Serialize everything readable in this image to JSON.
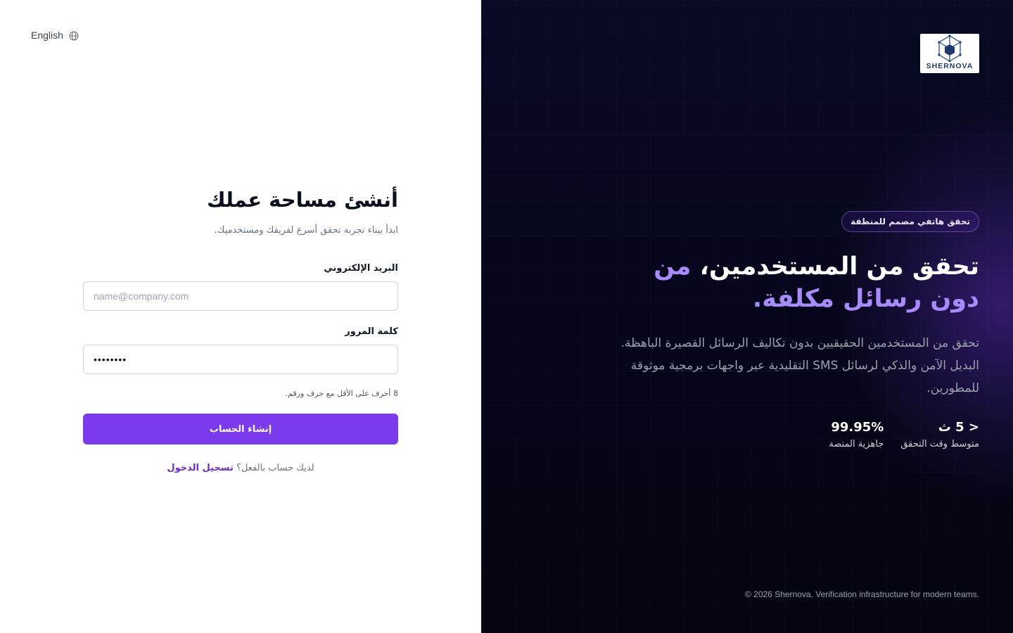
{
  "language_switch": {
    "label": "English",
    "icon": "globe-icon"
  },
  "signup": {
    "title": "أنشئ مساحة عملك",
    "subtitle": "ابدأ ببناء تجربة تحقق أسرع لفريقك ومستخدميك.",
    "email": {
      "label": "البريد الإلكتروني",
      "placeholder": "name@company.com",
      "value": ""
    },
    "password": {
      "label": "كلمة المرور",
      "value": "••••••••",
      "hint": "8 أحرف على الأقل مع حرف ورقم."
    },
    "submit_label": "إنشاء الحساب",
    "login_prompt": "لديك حساب بالفعل؟",
    "login_link": "تسجيل الدخول"
  },
  "brand": {
    "logo_text": "SHERNOVA",
    "logo_color": "#1f3a6e"
  },
  "hero": {
    "badge": "تحقق هاتفي مصمم للمنطقة",
    "headline_main": "تحقق من المستخدمين،",
    "headline_accent": "من دون رسائل مكلفة.",
    "description": "تحقق من المستخدمين الحقيقيين بدون تكاليف الرسائل القصيرة الباهظة. البديل الآمن والذكي لرسائل SMS التقليدية عبر واجهات برمجية موثوقة للمطورين.",
    "stats": [
      {
        "value": "< 5 ث",
        "label": "متوسط وقت التحقق"
      },
      {
        "value": "99.95%",
        "label": "جاهزية المنصة"
      }
    ]
  },
  "footer": {
    "text": "© 2026 Shernova. Verification infrastructure for modern teams."
  },
  "colors": {
    "accent": "#7c3aed",
    "accent_light": "#a78bfa",
    "panel_bg": "#05061a"
  }
}
